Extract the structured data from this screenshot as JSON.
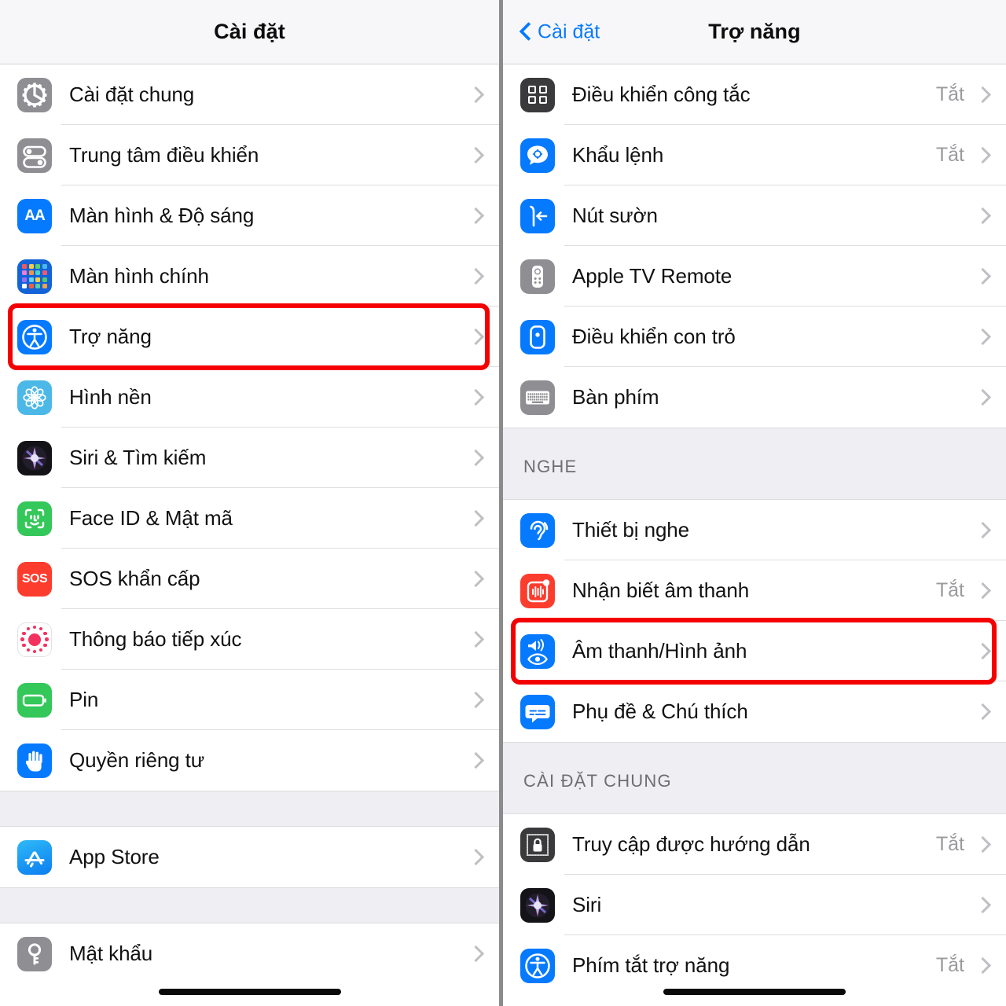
{
  "left_panel": {
    "nav": {
      "title": "Cài đặt"
    },
    "groups": [
      {
        "rows": [
          {
            "label": "Cài đặt chung",
            "icon": "gear-icon",
            "value": ""
          },
          {
            "label": "Trung tâm điều khiển",
            "icon": "control-center-icon",
            "value": ""
          },
          {
            "label": "Màn hình & Độ sáng",
            "icon": "display-brightness-icon",
            "value": ""
          },
          {
            "label": "Màn hình chính",
            "icon": "home-screen-icon",
            "value": ""
          },
          {
            "label": "Trợ năng",
            "icon": "accessibility-icon",
            "value": "",
            "highlighted": true
          },
          {
            "label": "Hình nền",
            "icon": "wallpaper-icon",
            "value": ""
          },
          {
            "label": "Siri & Tìm kiếm",
            "icon": "siri-icon",
            "value": ""
          },
          {
            "label": "Face ID & Mật mã",
            "icon": "face-id-icon",
            "value": ""
          },
          {
            "label": "SOS khẩn cấp",
            "icon": "sos-icon",
            "value": ""
          },
          {
            "label": "Thông báo tiếp xúc",
            "icon": "exposure-notification-icon",
            "value": ""
          },
          {
            "label": "Pin",
            "icon": "battery-icon",
            "value": ""
          },
          {
            "label": "Quyền riêng tư",
            "icon": "privacy-hand-icon",
            "value": ""
          }
        ]
      },
      {
        "rows": [
          {
            "label": "App Store",
            "icon": "app-store-icon",
            "value": ""
          }
        ]
      },
      {
        "rows": [
          {
            "label": "Mật khẩu",
            "icon": "passwords-key-icon",
            "value": ""
          }
        ]
      }
    ]
  },
  "right_panel": {
    "nav": {
      "back_label": "Cài đặt",
      "title": "Trợ năng"
    },
    "groups": [
      {
        "header": "",
        "rows": [
          {
            "label": "Điều khiển công tắc",
            "icon": "switch-control-icon",
            "value": "Tắt"
          },
          {
            "label": "Khẩu lệnh",
            "icon": "voice-control-icon",
            "value": "Tắt"
          },
          {
            "label": "Nút sườn",
            "icon": "side-button-icon",
            "value": ""
          },
          {
            "label": "Apple TV Remote",
            "icon": "apple-tv-remote-icon",
            "value": ""
          },
          {
            "label": "Điều khiển con trỏ",
            "icon": "pointer-control-icon",
            "value": ""
          },
          {
            "label": "Bàn phím",
            "icon": "keyboard-icon",
            "value": ""
          }
        ]
      },
      {
        "header": "NGHE",
        "rows": [
          {
            "label": "Thiết bị nghe",
            "icon": "hearing-devices-icon",
            "value": ""
          },
          {
            "label": "Nhận biết âm thanh",
            "icon": "sound-recognition-icon",
            "value": "Tắt"
          },
          {
            "label": "Âm thanh/Hình ảnh",
            "icon": "audio-visual-icon",
            "value": "",
            "highlighted": true
          },
          {
            "label": "Phụ đề & Chú thích",
            "icon": "subtitles-icon",
            "value": ""
          }
        ]
      },
      {
        "header": "CÀI ĐẶT CHUNG",
        "rows": [
          {
            "label": "Truy cập được hướng dẫn",
            "icon": "guided-access-icon",
            "value": "Tắt"
          },
          {
            "label": "Siri",
            "icon": "siri-icon",
            "value": ""
          },
          {
            "label": "Phím tắt trợ năng",
            "icon": "accessibility-icon",
            "value": "Tắt"
          }
        ]
      }
    ]
  },
  "colors": {
    "accent_blue": "#067aff",
    "highlight_red": "#f40000",
    "value_gray": "#9a9a9f",
    "group_bg": "#efeef3",
    "frame_gray": "#8b8b8b"
  }
}
